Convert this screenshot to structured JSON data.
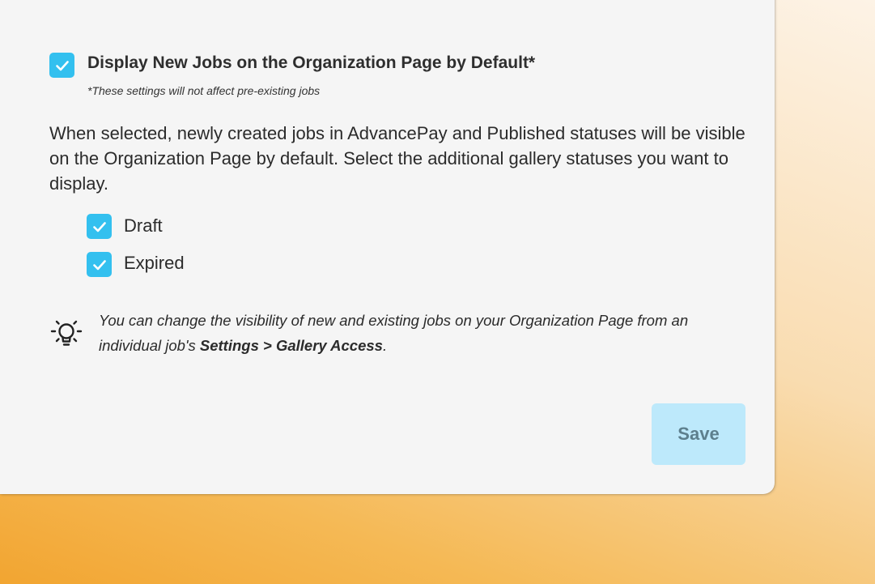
{
  "settings": {
    "display_default": {
      "checked": true,
      "title": "Display New Jobs on the Organization Page by Default*",
      "footnote": "*These settings will not affect pre-existing jobs"
    },
    "description": "When selected, newly created jobs in AdvancePay and Published statuses will be visible on the Organization Page by default. Select the additional gallery statuses you want to display.",
    "statuses": [
      {
        "label": "Draft",
        "checked": true
      },
      {
        "label": "Expired",
        "checked": true
      }
    ],
    "tip": {
      "icon": "lightbulb-icon",
      "text_before": "You can change the visibility of new and existing jobs on your Organization Page from an individual job's ",
      "text_bold": "Settings > Gallery Access",
      "text_after": "."
    },
    "save_label": "Save"
  },
  "colors": {
    "checkbox_accent": "#33c0ef",
    "save_button_bg": "#bde9fb",
    "save_button_text": "#5d7f8d",
    "panel_bg": "#f5f5f5"
  }
}
